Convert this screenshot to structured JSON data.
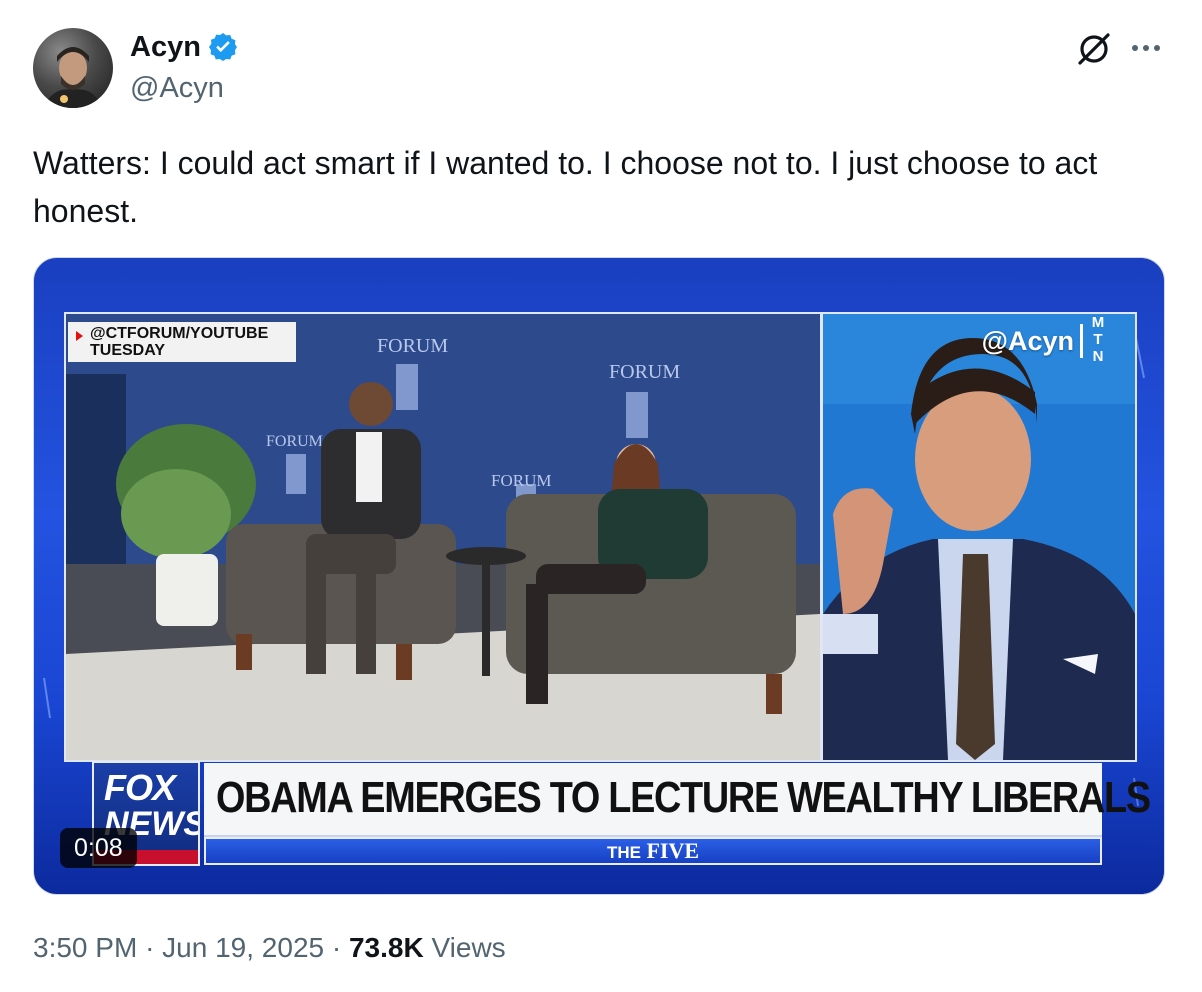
{
  "author": {
    "display_name": "Acyn",
    "handle": "@Acyn",
    "verified": true,
    "verified_color": "#1d9bf0"
  },
  "actions": {
    "grok_icon": "grok-slash-circle-icon",
    "more_icon": "more-horizontal-icon"
  },
  "tweet": {
    "text": "Watters: I could act smart if I wanted to. I choose not to. I just choose to act honest."
  },
  "video": {
    "source_tag_line1": "@CTFORUM/YOUTUBE",
    "source_tag_line2": "TUESDAY",
    "watermark": "@Acyn",
    "mtn_letters": [
      "M",
      "T",
      "N"
    ],
    "network_logo_line1": "FOX",
    "network_logo_line2": "NEWS",
    "headline": "OBAMA EMERGES TO LECTURE WEALTHY LIBERALS",
    "show_prefix": "THE",
    "show_name": "FIVE",
    "duration": "0:08",
    "stage_sign_text": "FORUM"
  },
  "meta": {
    "time": "3:50 PM",
    "separator": "·",
    "date": "Jun 19, 2025",
    "views_count": "73.8K",
    "views_label": "Views"
  }
}
